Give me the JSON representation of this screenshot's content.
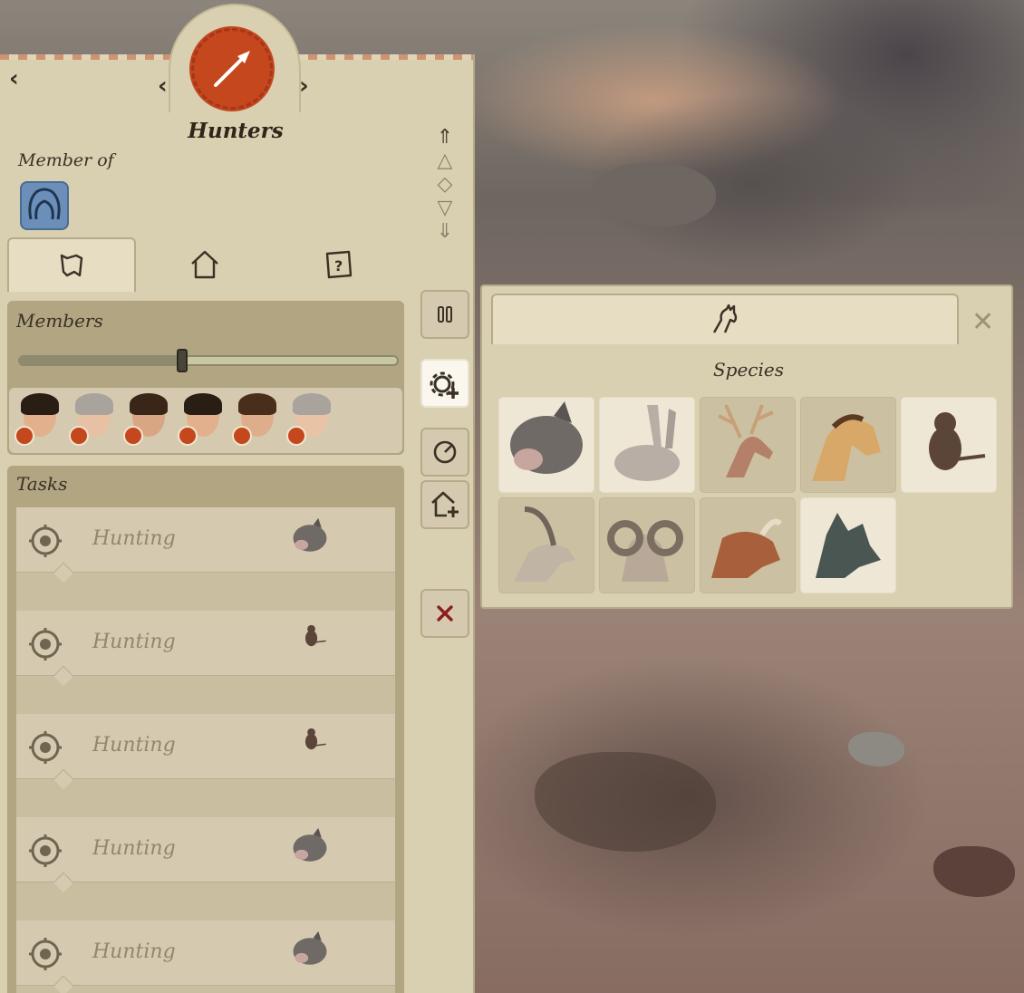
{
  "header": {
    "title": "Hunters",
    "member_of_label": "Member of",
    "prev_arrow": "‹",
    "next_arrow": "›",
    "back_arrow": "‹"
  },
  "tabs": [
    {
      "icon": "map-icon",
      "active": true
    },
    {
      "icon": "house-icon",
      "active": false
    },
    {
      "icon": "help-scroll-icon",
      "active": false
    }
  ],
  "priority_arrows": [
    "top-priority-icon",
    "up-priority-icon",
    "neutral-priority-icon",
    "down-priority-icon",
    "bottom-priority-icon"
  ],
  "members": {
    "title": "Members",
    "slider_level": 0.43,
    "people": [
      {
        "hair": "#2a1d14",
        "skin": "#e2b08c"
      },
      {
        "hair": "#a8a39c",
        "skin": "#e8c0a4"
      },
      {
        "hair": "#3a2618",
        "skin": "#d9a683"
      },
      {
        "hair": "#2a1d14",
        "skin": "#e2b08c"
      },
      {
        "hair": "#4a2e1c",
        "skin": "#deae8c"
      },
      {
        "hair": "#a8a39c",
        "skin": "#eac3a6"
      }
    ]
  },
  "tasks": {
    "title": "Tasks",
    "items": [
      {
        "label": "Hunting",
        "animal": "boar"
      },
      {
        "label": "Hunting",
        "animal": "rat"
      },
      {
        "label": "Hunting",
        "animal": "rat"
      },
      {
        "label": "Hunting",
        "animal": "boar"
      },
      {
        "label": "Hunting",
        "animal": "boar"
      }
    ]
  },
  "side_buttons": [
    {
      "icon": "pause-icon",
      "active": false
    },
    {
      "icon": "gear-plus-icon",
      "active": true
    },
    {
      "icon": "target-icon",
      "active": false
    },
    {
      "icon": "house-plus-icon",
      "active": false
    },
    {
      "icon": "close-icon",
      "active": false
    }
  ],
  "species_panel": {
    "title": "Species",
    "close_label": "✕",
    "animals": [
      {
        "name": "boar",
        "selected": true
      },
      {
        "name": "hare",
        "selected": true
      },
      {
        "name": "deer",
        "selected": false
      },
      {
        "name": "horse",
        "selected": false
      },
      {
        "name": "rat",
        "selected": true
      },
      {
        "name": "ibex",
        "selected": false
      },
      {
        "name": "mouflon",
        "selected": false
      },
      {
        "name": "aurochs",
        "selected": false
      },
      {
        "name": "wolf",
        "selected": true
      }
    ]
  },
  "colors": {
    "panel": "#d9cfb1",
    "emblem": "#c4471d",
    "close_red": "#8a1e1e"
  }
}
